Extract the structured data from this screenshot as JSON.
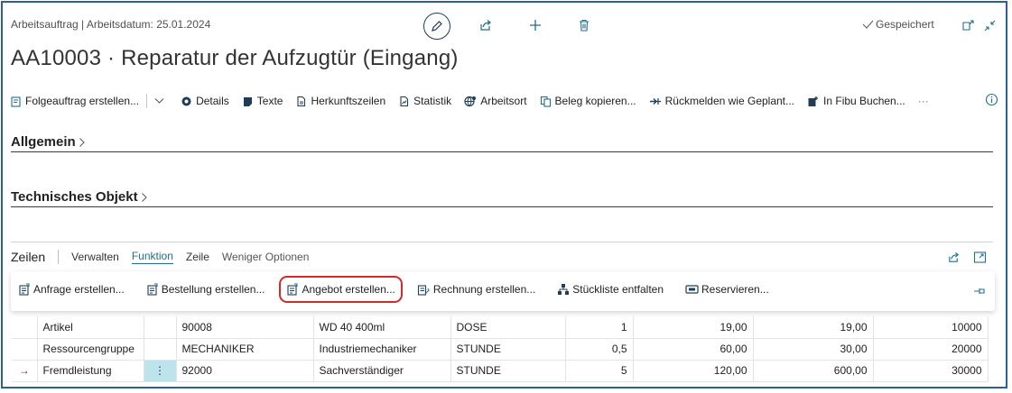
{
  "header": {
    "breadcrumb": "Arbeitsauftrag | Arbeitsdatum: 25.01.2024",
    "saved_status": "Gespeichert",
    "title": "AA10003 · Reparatur der Aufzugtür (Eingang)"
  },
  "toolbar": {
    "items": [
      {
        "label": "Folgeauftrag erstellen...",
        "icon": "followup-order-icon"
      },
      {
        "label": "Details",
        "icon": "details-icon"
      },
      {
        "label": "Texte",
        "icon": "texts-icon"
      },
      {
        "label": "Herkunftszeilen",
        "icon": "source-lines-icon"
      },
      {
        "label": "Statistik",
        "icon": "statistics-icon"
      },
      {
        "label": "Arbeitsort",
        "icon": "work-location-icon"
      },
      {
        "label": "Beleg kopieren...",
        "icon": "copy-document-icon"
      },
      {
        "label": "Rückmelden wie Geplant...",
        "icon": "report-as-planned-icon"
      },
      {
        "label": "In Fibu Buchen...",
        "icon": "post-to-finance-icon"
      }
    ],
    "more": "···"
  },
  "sections": {
    "general": "Allgemein",
    "technical_object": "Technisches Objekt"
  },
  "lines": {
    "title": "Zeilen",
    "tabs": [
      "Verwalten",
      "Funktion",
      "Zeile",
      "Weniger Optionen"
    ],
    "active_tab": "Funktion",
    "actions": [
      {
        "label": "Anfrage erstellen...",
        "icon": "request-icon"
      },
      {
        "label": "Bestellung erstellen...",
        "icon": "order-icon"
      },
      {
        "label": "Angebot erstellen...",
        "icon": "quote-icon",
        "highlighted": true
      },
      {
        "label": "Rechnung erstellen...",
        "icon": "invoice-icon"
      },
      {
        "label": "Stückliste entfalten",
        "icon": "bom-explode-icon"
      },
      {
        "label": "Reservieren...",
        "icon": "reserve-icon"
      }
    ],
    "rows": [
      {
        "marker": "",
        "type": "Artikel",
        "menu": "",
        "no": "90008",
        "description": "WD 40 400ml",
        "unit": "DOSE",
        "qty": "1",
        "unit_price": "19,00",
        "amount": "19,00",
        "line_no": "10000"
      },
      {
        "marker": "",
        "type": "Ressourcengruppe",
        "menu": "",
        "no": "MECHANIKER",
        "description": "Industriemechaniker",
        "unit": "STUNDE",
        "qty": "0,5",
        "unit_price": "60,00",
        "amount": "30,00",
        "line_no": "20000"
      },
      {
        "marker": "→",
        "type": "Fremdleistung",
        "menu": "⋮",
        "no": "92000",
        "description": "Sachverständiger",
        "unit": "STUNDE",
        "qty": "5",
        "unit_price": "120,00",
        "amount": "600,00",
        "line_no": "30000"
      }
    ]
  },
  "colors": {
    "accent": "#1f6f8b",
    "highlight_border": "#d62828",
    "frame_border": "#2f5f8f",
    "selected_cell": "#bde3ec"
  }
}
